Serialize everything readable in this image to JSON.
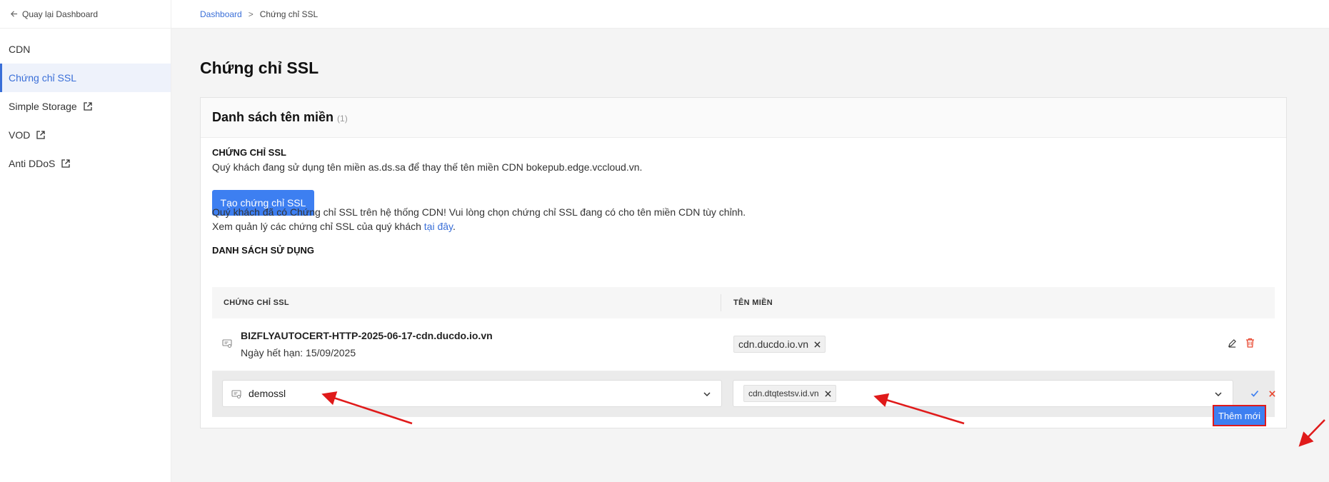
{
  "sidebar": {
    "back_label": "Quay lại Dashboard",
    "items": [
      {
        "label": "CDN"
      },
      {
        "label": "Chứng chỉ SSL"
      },
      {
        "label": "Simple Storage"
      },
      {
        "label": "VOD"
      },
      {
        "label": "Anti DDoS"
      }
    ]
  },
  "breadcrumb": {
    "root": "Dashboard",
    "sep": ">",
    "current": "Chứng chỉ SSL"
  },
  "page": {
    "title": "Chứng chỉ SSL"
  },
  "card": {
    "title": "Danh sách tên miền",
    "count": "(1)",
    "ssl_label": "CHỨNG CHỈ SSL",
    "ssl_desc": "Quý khách đang sử dụng tên miền as.ds.sa để thay thế tên miền CDN bokepub.edge.vccloud.vn.",
    "create_button": "Tạo chứng chỉ SSL",
    "info_line1": "Quý khách đã có Chứng chỉ SSL trên hệ thống CDN! Vui lòng chọn chứng chỉ SSL đang có cho tên miền CDN tùy chỉnh.",
    "info_line2_prefix": "Xem quản lý các chứng chỉ SSL của quý khách ",
    "info_line2_link": "tại đây",
    "info_line2_suffix": ".",
    "usage_label": "DANH SÁCH SỬ DỤNG"
  },
  "table": {
    "col_cert": "CHỨNG CHỈ SSL",
    "col_domain": "TÊN MIỀN",
    "row": {
      "cert_name": "BIZFLYAUTOCERT-HTTP-2025-06-17-cdn.ducdo.io.vn",
      "expiry": "Ngày hết hạn: 15/09/2025",
      "domain_tag": "cdn.ducdo.io.vn"
    },
    "edit_row": {
      "cert_value": "demossl",
      "domain_tag": "cdn.dtqtestsv.id.vn"
    }
  },
  "add_button": "Thêm mới",
  "colors": {
    "accent": "#3d7ff1",
    "highlight": "#e01a1a",
    "delete": "#e8462f"
  }
}
